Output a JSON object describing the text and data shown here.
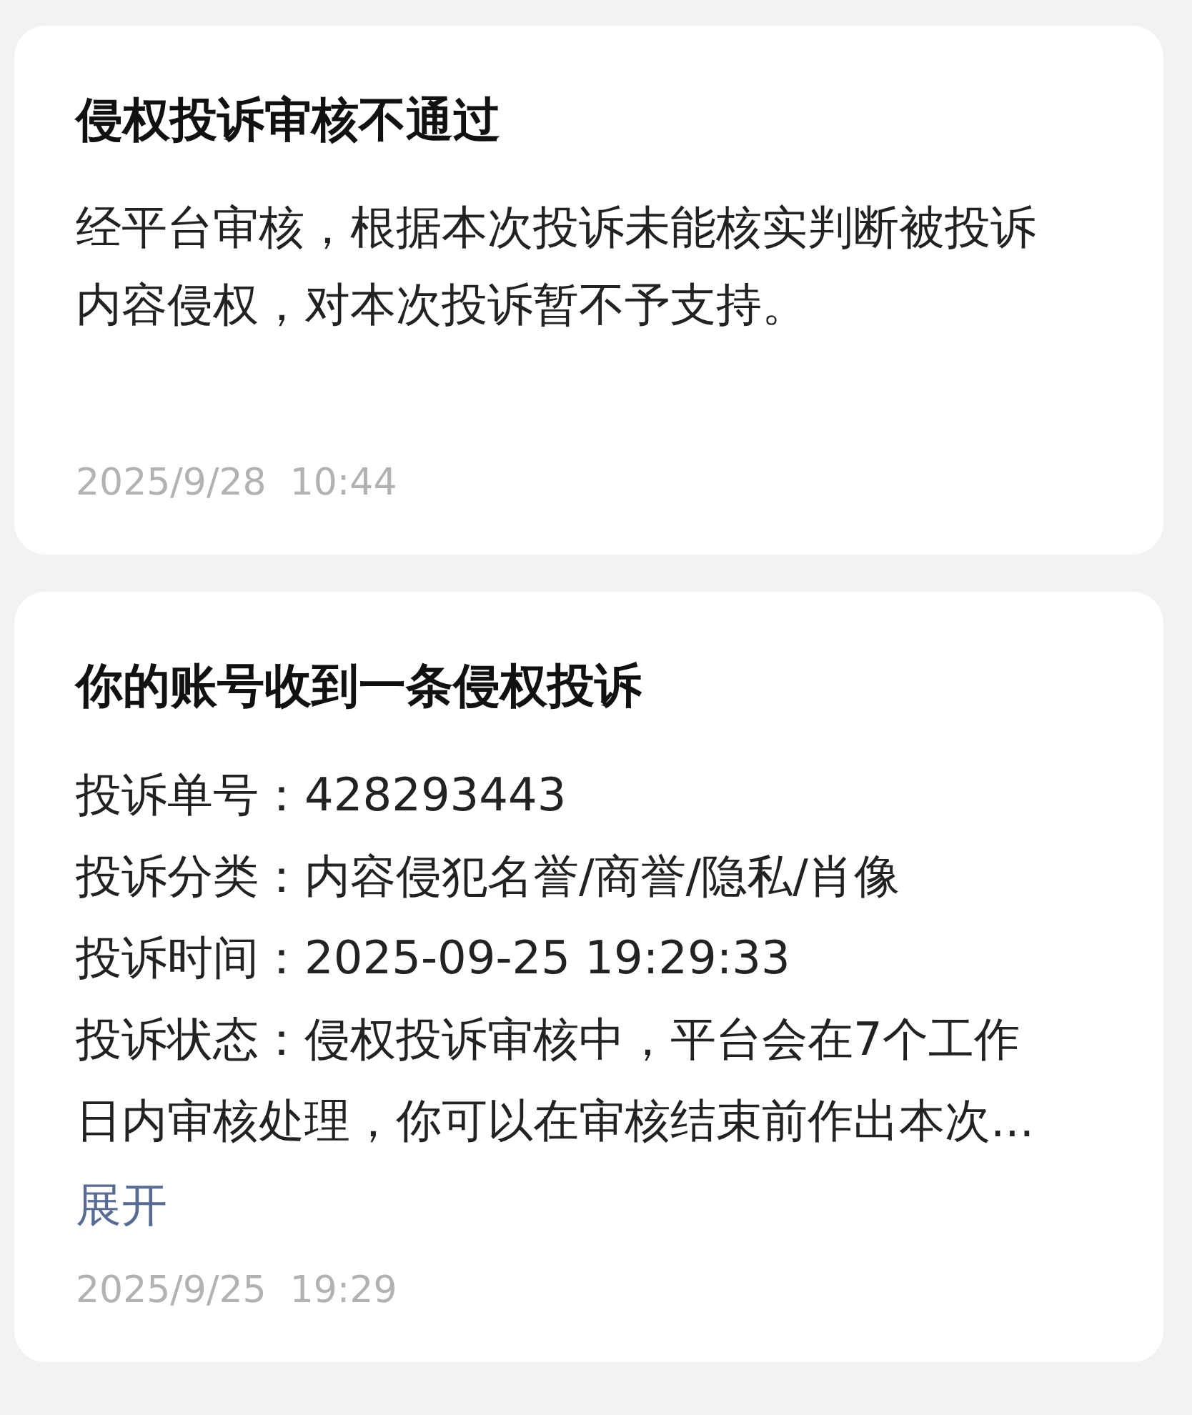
{
  "notifications": [
    {
      "title": "侵权投诉审核不通过",
      "body": "经平台审核，根据本次投诉未能核实判断被投诉内容侵权，对本次投诉暂不予支持。",
      "time": "2025/9/28  10:44"
    },
    {
      "title": "你的账号收到一条侵权投诉",
      "fields": [
        "投诉单号：428293443",
        "投诉分类：内容侵犯名誉/商誉/隐私/肖像",
        "投诉时间：2025-09-25 19:29:33",
        "投诉状态：侵权投诉审核中，平台会在7个工作日内审核处理，你可以在审核结束前作出本次..."
      ],
      "expand_link": "展开",
      "time": "2025/9/25  19:29"
    }
  ]
}
